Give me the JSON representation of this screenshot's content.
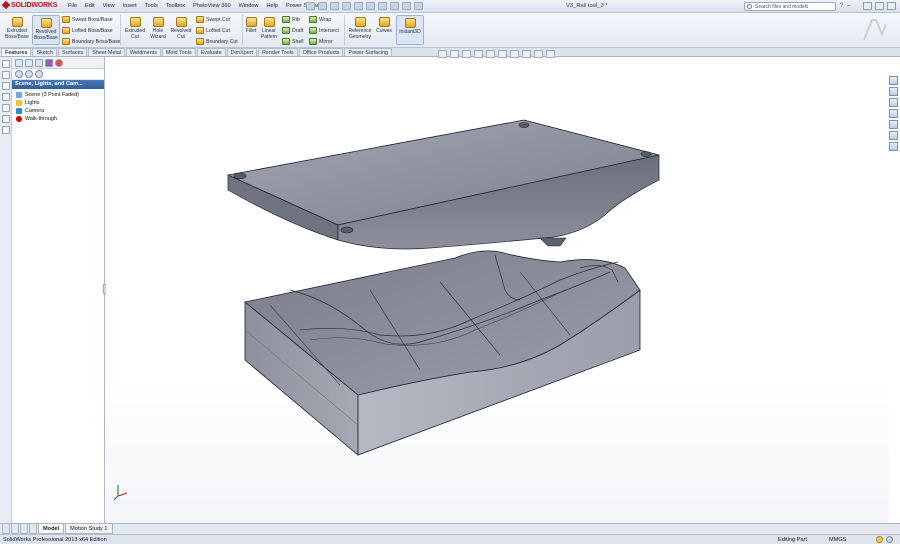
{
  "app": {
    "logo_text": "SOLIDWORKS",
    "document_title": "V3_Rail tool_3 *"
  },
  "menu": [
    "File",
    "Edit",
    "View",
    "Insert",
    "Tools",
    "Toolbox",
    "PhotoView 360",
    "Window",
    "Help",
    "Power Surfacing"
  ],
  "search": {
    "placeholder": "Search files and models"
  },
  "commands": {
    "extruded_boss": "Extruded Boss/Base",
    "revolved_boss": "Revolved Boss/Base",
    "swept_boss": "Swept Boss/Base",
    "lofted_boss": "Lofted Boss/Base",
    "boundary_boss": "Boundary Boss/Base",
    "extruded_cut": "Extruded Cut",
    "hole_wizard": "Hole Wizard",
    "revolved_cut": "Revolved Cut",
    "swept_cut": "Swept Cut",
    "lofted_cut": "Lofted Cut",
    "boundary_cut": "Boundary Cut",
    "fillet": "Fillet",
    "linear_pattern": "Linear Pattern",
    "rib": "Rib",
    "draft": "Draft",
    "shell": "Shell",
    "wrap": "Wrap",
    "intersect": "Intersect",
    "mirror": "Mirror",
    "reference_geometry": "Reference Geometry",
    "curves": "Curves",
    "instant3d": "Instant3D"
  },
  "tabs": [
    "Features",
    "Sketch",
    "Surfaces",
    "Sheet Metal",
    "Weldments",
    "Mold Tools",
    "Evaluate",
    "DimXpert",
    "Render Tools",
    "Office Products",
    "Power Surfacing"
  ],
  "active_tab": "Features",
  "feature_pane": {
    "header": "Scene, Lights, and Cam...",
    "tree": [
      {
        "label": "Scene (3 Point Faded)",
        "icon": "scene-icon"
      },
      {
        "label": "Lights",
        "icon": "lights-icon"
      },
      {
        "label": "Camera",
        "icon": "camera-icon"
      },
      {
        "label": "Walk-through",
        "icon": "walk-through-icon"
      }
    ]
  },
  "bottom_tabs": [
    "Model",
    "Motion Study 1"
  ],
  "status": {
    "left": "SolidWorks Professional 2013 x64 Edition",
    "mode": "Editing Part",
    "units": "MMGS"
  },
  "colors": {
    "logo_red": "#c1121f",
    "model_gray": "#8a8d99",
    "model_edge": "#1f2230",
    "header_blue": "#2f5d9c"
  }
}
